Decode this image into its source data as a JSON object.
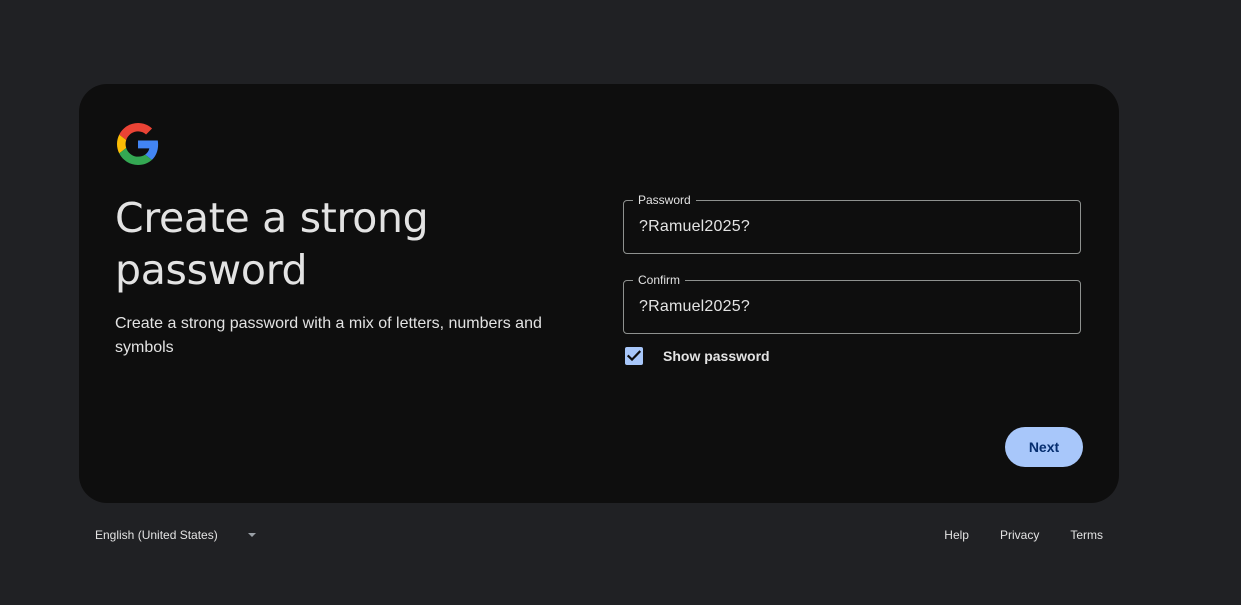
{
  "logo": {
    "name": "google-logo",
    "colors": {
      "blue": "#4285F4",
      "red": "#EA4335",
      "yellow": "#FBBC05",
      "green": "#34A853"
    }
  },
  "heading": "Create a strong password",
  "subheading": "Create a strong password with a mix of letters, numbers and symbols",
  "password_field": {
    "label": "Password",
    "value": "?Ramuel2025?"
  },
  "confirm_field": {
    "label": "Confirm",
    "value": "?Ramuel2025?"
  },
  "show_password": {
    "label": "Show password",
    "checked": true
  },
  "next_button": {
    "label": "Next"
  },
  "footer": {
    "language": "English (United States)",
    "links": {
      "help": "Help",
      "privacy": "Privacy",
      "terms": "Terms"
    }
  },
  "colors": {
    "page_bg": "#202124",
    "card_bg": "#0e0e0e",
    "accent": "#a8c7fa",
    "button_text": "#062e6f"
  }
}
